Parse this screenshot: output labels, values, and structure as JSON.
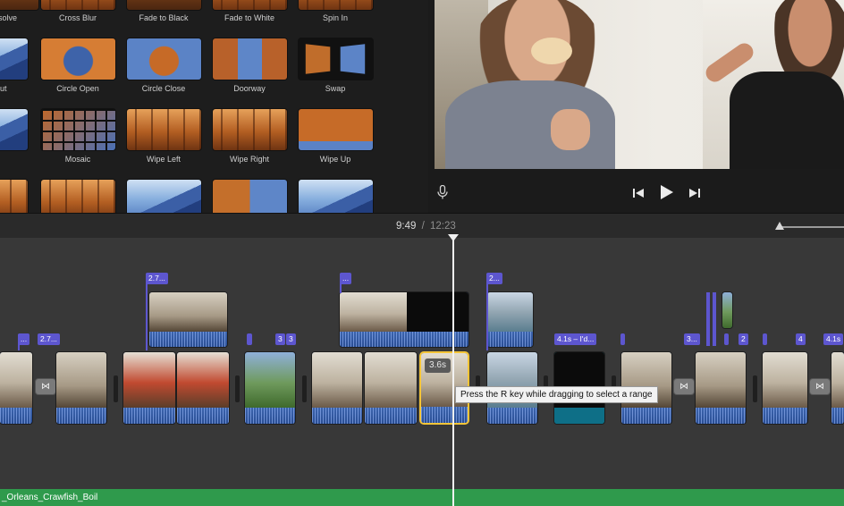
{
  "transitions": {
    "row1": [
      {
        "label": "solve",
        "thumb": "th-dark"
      },
      {
        "label": "Cross Blur",
        "thumb": "th-forest"
      },
      {
        "label": "Fade to Black",
        "thumb": "th-dark"
      },
      {
        "label": "Fade to White",
        "thumb": "th-forest"
      },
      {
        "label": "Spin In",
        "thumb": "th-forest"
      }
    ],
    "row2": [
      {
        "label": "ut",
        "thumb": "th-mount"
      },
      {
        "label": "Circle Open",
        "thumb": "th-circle"
      },
      {
        "label": "Circle Close",
        "thumb": "th-circle2"
      },
      {
        "label": "Doorway",
        "thumb": "th-door"
      },
      {
        "label": "Swap",
        "thumb": "th-swap"
      }
    ],
    "row3": [
      {
        "label": "",
        "thumb": "th-mount"
      },
      {
        "label": "Mosaic",
        "thumb": "th-mosaic"
      },
      {
        "label": "Wipe Left",
        "thumb": "th-forest"
      },
      {
        "label": "Wipe Right",
        "thumb": "th-forest"
      },
      {
        "label": "Wipe Up",
        "thumb": "th-wipe"
      }
    ]
  },
  "viewer": {
    "mic_icon": "microphone-icon",
    "prev_icon": "skip-back-icon",
    "play_icon": "play-icon",
    "next_icon": "skip-forward-icon"
  },
  "timeline": {
    "current_time": "9:49",
    "separator": "/",
    "total_duration": "12:23",
    "flags": [
      "2.7...",
      "2.7...",
      "...",
      "2...",
      "4.1s – I'd...",
      "3...",
      "4.1s",
      "3",
      "3",
      "...",
      "4",
      "2",
      "..."
    ],
    "selected_clip_duration": "3.6s",
    "tooltip": "Press the R key while dragging to select a range",
    "transition_icon": "bowtie-icon",
    "music_track": "_Orleans_Crawfish_Boil",
    "colors": {
      "title_flag": "#5d56cf",
      "audio": "#2d4d86",
      "music": "#2f9a4c",
      "selection": "#f5c537"
    }
  }
}
